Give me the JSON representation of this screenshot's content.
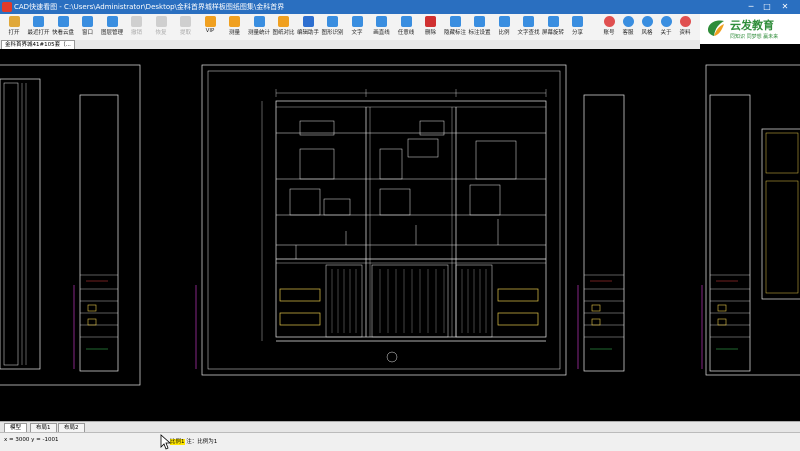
{
  "window": {
    "title": "CAD快速看图 - C:\\Users\\Administrator\\Desktop\\金科首界城样板图纸图集\\金科首界城41#105套（修改后方案）.dwg",
    "controls": [
      "─",
      "□",
      "✕"
    ]
  },
  "toolbar": {
    "items": [
      {
        "label": "打开",
        "icon": "folder-icon",
        "color": "#e0a83a",
        "enabled": true
      },
      {
        "label": "最近打开",
        "icon": "recent-icon",
        "color": "#3a8ee0",
        "enabled": true
      },
      {
        "label": "快看云盘",
        "icon": "cloud-icon",
        "color": "#3a8ee0",
        "enabled": true
      },
      {
        "label": "窗口",
        "icon": "window-icon",
        "color": "#3a8ee0",
        "enabled": true
      },
      {
        "label": "图层管理",
        "icon": "layers-icon",
        "color": "#3a8ee0",
        "enabled": true
      },
      {
        "label": "撤销",
        "icon": "undo-icon",
        "color": "#cccccc",
        "enabled": false
      },
      {
        "label": "恢复",
        "icon": "redo-icon",
        "color": "#cccccc",
        "enabled": false
      },
      {
        "label": "提取",
        "icon": "extract-icon",
        "color": "#cccccc",
        "enabled": false
      },
      {
        "label": "VIP",
        "icon": "vip-icon",
        "color": "#f0a020",
        "enabled": true
      },
      {
        "label": "测量",
        "icon": "measure-icon",
        "color": "#f0a020",
        "enabled": true
      },
      {
        "label": "测量统计",
        "icon": "stats-icon",
        "color": "#3a8ee0",
        "enabled": true
      },
      {
        "label": "图纸对比",
        "icon": "compare-icon",
        "color": "#f0a020",
        "enabled": true
      },
      {
        "label": "编辑助手",
        "icon": "edit-helper-icon",
        "color": "#2e6fd0",
        "enabled": true
      },
      {
        "label": "图形识别",
        "icon": "recognize-icon",
        "color": "#3a8ee0",
        "enabled": true
      },
      {
        "label": "文字",
        "icon": "text-icon",
        "color": "#3a8ee0",
        "enabled": true
      },
      {
        "label": "画直线",
        "icon": "line-icon",
        "color": "#3a8ee0",
        "enabled": true
      },
      {
        "label": "任意线",
        "icon": "freeline-icon",
        "color": "#3a8ee0",
        "enabled": true
      },
      {
        "label": "删除",
        "icon": "delete-icon",
        "color": "#d03030",
        "enabled": true
      },
      {
        "label": "隐藏标注",
        "icon": "hide-mark-icon",
        "color": "#3a8ee0",
        "enabled": true
      },
      {
        "label": "标注设置",
        "icon": "mark-settings-icon",
        "color": "#3a8ee0",
        "enabled": true
      },
      {
        "label": "比例",
        "icon": "scale-icon",
        "color": "#3a8ee0",
        "enabled": true
      },
      {
        "label": "文字查找",
        "icon": "text-search-icon",
        "color": "#3a8ee0",
        "enabled": true
      },
      {
        "label": "屏幕旋转",
        "icon": "rotate-icon",
        "color": "#3a8ee0",
        "enabled": true
      },
      {
        "label": "分享",
        "icon": "share-icon",
        "color": "#3a8ee0",
        "enabled": true
      }
    ],
    "right_items": [
      {
        "label": "账号",
        "icon": "account-icon",
        "color": "#e05050"
      },
      {
        "label": "客服",
        "icon": "support-icon",
        "color": "#3a8ee0"
      },
      {
        "label": "风格",
        "icon": "style-icon",
        "color": "#3a8ee0"
      },
      {
        "label": "关于",
        "icon": "about-icon",
        "color": "#3a8ee0"
      },
      {
        "label": "资料",
        "icon": "docs-icon",
        "color": "#e05050"
      }
    ]
  },
  "logo": {
    "name": "云发教育",
    "slogan": "同知识 同梦想 赢未来",
    "color": "#2f8d3a"
  },
  "document_tab": {
    "label": "金科首界城41#105套（..."
  },
  "layout_tabs": [
    "模型",
    "布局1",
    "布局2"
  ],
  "status": {
    "coords": "x = 3000  y = -1001",
    "scale_label": "注：比例为1",
    "scale_highlight": "比例1"
  },
  "drawing": {
    "line_color": "#e8e8e8",
    "accent_yellow": "#e6c84a",
    "accent_magenta": "#e040e0",
    "accent_red": "#e04040",
    "accent_green": "#40d060"
  }
}
